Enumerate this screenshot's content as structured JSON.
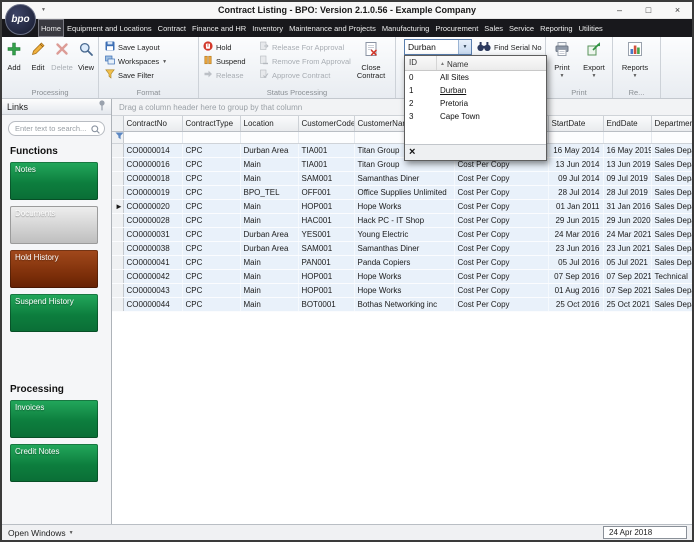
{
  "window": {
    "title": "Contract Listing - BPO: Version 2.1.0.56 - Example Company",
    "logo_text": "bpo",
    "controls": {
      "minimize": "–",
      "maximize": "□",
      "close": "×"
    }
  },
  "tabs": {
    "selected": "Home",
    "items": [
      "Home",
      "Equipment and Locations",
      "Contract",
      "Finance and HR",
      "Inventory",
      "Maintenance and Projects",
      "Manufacturing",
      "Procurement",
      "Sales",
      "Service",
      "Reporting",
      "Utilities"
    ]
  },
  "ribbon": {
    "processing": {
      "label": "Processing",
      "add": "Add",
      "edit": "Edit",
      "del": "Delete",
      "view": "View"
    },
    "format": {
      "label": "Format",
      "save_layout": "Save Layout",
      "workspaces": "Workspaces",
      "save_filter": "Save Filter"
    },
    "status": {
      "label": "Status Processing",
      "hold": "Hold",
      "suspend": "Suspend",
      "release": "Release",
      "release_for_approval": "Release For Approval",
      "remove_from_approval": "Remove From Approval",
      "approve_contract": "Approve Contract",
      "close_contract": "Close Contract"
    },
    "site": {
      "combo_value": "Durban",
      "find_serial": "Find Serial No"
    },
    "print_group": {
      "label": "Print",
      "print": "Print",
      "export": "Export"
    },
    "reports_group": {
      "label": "Re...",
      "reports": "Reports"
    }
  },
  "site_dropdown": {
    "columns": [
      "ID",
      "Name"
    ],
    "rows": [
      [
        "0",
        "All Sites"
      ],
      [
        "1",
        "Durban"
      ],
      [
        "2",
        "Pretoria"
      ],
      [
        "3",
        "Cape Town"
      ]
    ],
    "selected": "Durban",
    "close_glyph": "×"
  },
  "sidebar": {
    "header": "Links",
    "search_placeholder": "Enter text to search...",
    "sections": [
      {
        "title": "Functions",
        "items": [
          {
            "label": "Notes",
            "color": "green"
          },
          {
            "label": "Documents",
            "color": "silver"
          },
          {
            "label": "Hold History",
            "color": "maroon"
          },
          {
            "label": "Suspend History",
            "color": "green"
          }
        ]
      },
      {
        "title": "Processing",
        "items": [
          {
            "label": "Invoices",
            "color": "green"
          },
          {
            "label": "Credit Notes",
            "color": "green"
          }
        ]
      }
    ]
  },
  "grid": {
    "group_hint": "Drag a column header here to group by that column",
    "columns": [
      "ContractNo",
      "ContractType",
      "Location",
      "CustomerCode",
      "CustomerName",
      "",
      "StartDate",
      "EndDate",
      "DepartmentName"
    ],
    "selected_index": 4,
    "rows": [
      [
        "CO0000014",
        "CPC",
        "Durban Area",
        "TIA001",
        "Titan Group",
        "Cost Per Copy",
        "16 May 2014",
        "16 May 2019",
        "Sales Department"
      ],
      [
        "CO0000016",
        "CPC",
        "Main",
        "TIA001",
        "Titan Group",
        "Cost Per Copy",
        "13 Jun 2014",
        "13 Jun 2019",
        "Sales Department"
      ],
      [
        "CO0000018",
        "CPC",
        "Main",
        "SAM001",
        "Samanthas Diner",
        "Cost Per Copy",
        "09 Jul 2014",
        "09 Jul 2019",
        "Sales Department"
      ],
      [
        "CO0000019",
        "CPC",
        "BPO_TEL",
        "OFF001",
        "Office Supplies Unlimited",
        "Cost Per Copy",
        "28 Jul 2014",
        "28 Jul 2019",
        "Sales Department"
      ],
      [
        "CO0000020",
        "CPC",
        "Main",
        "HOP001",
        "Hope Works",
        "Cost Per Copy",
        "01 Jan 2011",
        "31 Jan 2016",
        "Sales Department"
      ],
      [
        "CO0000028",
        "CPC",
        "Main",
        "HAC001",
        "Hack PC - IT Shop",
        "Cost Per Copy",
        "29 Jun 2015",
        "29 Jun 2020",
        "Sales Department"
      ],
      [
        "CO0000031",
        "CPC",
        "Durban Area",
        "YES001",
        "Young Electric",
        "Cost Per Copy",
        "24 Mar 2016",
        "24 Mar 2021",
        "Sales Department"
      ],
      [
        "CO0000038",
        "CPC",
        "Durban Area",
        "SAM001",
        "Samanthas Diner",
        "Cost Per Copy",
        "23 Jun 2016",
        "23 Jun 2021",
        "Sales Department"
      ],
      [
        "CO0000041",
        "CPC",
        "Main",
        "PAN001",
        "Panda Copiers",
        "Cost Per Copy",
        "05 Jul 2016",
        "05 Jul 2021",
        "Sales Department"
      ],
      [
        "CO0000042",
        "CPC",
        "Main",
        "HOP001",
        "Hope Works",
        "Cost Per Copy",
        "07 Sep 2016",
        "07 Sep 2021",
        "Technical"
      ],
      [
        "CO0000043",
        "CPC",
        "Main",
        "HOP001",
        "Hope Works",
        "Cost Per Copy",
        "01 Aug 2016",
        "07 Sep 2021",
        "Sales Department"
      ],
      [
        "CO0000044",
        "CPC",
        "Main",
        "BOT0001",
        "Bothas Networking inc",
        "Cost Per Copy",
        "25 Oct 2016",
        "25 Oct 2021",
        "Sales Department"
      ]
    ]
  },
  "statusbar": {
    "open_windows": "Open Windows",
    "date": "24 Apr 2018"
  },
  "glyphs": {
    "dropdown_arrow": "▼",
    "row_marker": "►",
    "sort_asc": "▲"
  },
  "colors": {
    "green": "#0d7e3e",
    "maroon": "#7a2d08",
    "silver": "#c9c9c9",
    "grid_row": "#e9f1fa",
    "accent_red": "#d2382b"
  }
}
